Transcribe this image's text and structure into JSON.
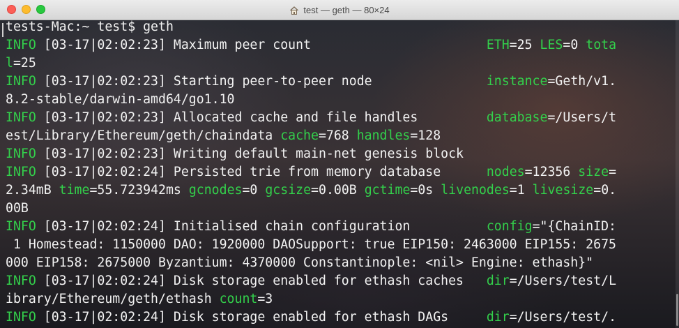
{
  "window": {
    "title": "test — geth — 80×24"
  },
  "terminal": {
    "prompt": "tests-Mac:~ test$ geth",
    "lines": [
      [
        {
          "t": "INFO",
          "c": "lvl"
        },
        {
          "t": " [03-17|02:02:23] Maximum peer count                       "
        },
        {
          "t": "ETH",
          "c": "key"
        },
        {
          "t": "=25 "
        },
        {
          "t": "LES",
          "c": "key"
        },
        {
          "t": "=0 "
        },
        {
          "t": "tota",
          "c": "key"
        }
      ],
      [
        {
          "t": "l",
          "c": "key"
        },
        {
          "t": "=25"
        }
      ],
      [
        {
          "t": "INFO",
          "c": "lvl"
        },
        {
          "t": " [03-17|02:02:23] Starting peer-to-peer node               "
        },
        {
          "t": "instance",
          "c": "key"
        },
        {
          "t": "=Geth/v1."
        }
      ],
      [
        {
          "t": "8.2-stable/darwin-amd64/go1.10"
        }
      ],
      [
        {
          "t": "INFO",
          "c": "lvl"
        },
        {
          "t": " [03-17|02:02:23] Allocated cache and file handles         "
        },
        {
          "t": "database",
          "c": "key"
        },
        {
          "t": "=/Users/t"
        }
      ],
      [
        {
          "t": "est/Library/Ethereum/geth/chaindata "
        },
        {
          "t": "cache",
          "c": "key"
        },
        {
          "t": "=768 "
        },
        {
          "t": "handles",
          "c": "key"
        },
        {
          "t": "=128"
        }
      ],
      [
        {
          "t": "INFO",
          "c": "lvl"
        },
        {
          "t": " [03-17|02:02:23] Writing default main-net genesis block"
        }
      ],
      [
        {
          "t": "INFO",
          "c": "lvl"
        },
        {
          "t": " [03-17|02:02:24] Persisted trie from memory database      "
        },
        {
          "t": "nodes",
          "c": "key"
        },
        {
          "t": "=12356 "
        },
        {
          "t": "size",
          "c": "key"
        },
        {
          "t": "="
        }
      ],
      [
        {
          "t": "2.34mB "
        },
        {
          "t": "time",
          "c": "key"
        },
        {
          "t": "=55.723942ms "
        },
        {
          "t": "gcnodes",
          "c": "key"
        },
        {
          "t": "=0 "
        },
        {
          "t": "gcsize",
          "c": "key"
        },
        {
          "t": "=0.00B "
        },
        {
          "t": "gctime",
          "c": "key"
        },
        {
          "t": "=0s "
        },
        {
          "t": "livenodes",
          "c": "key"
        },
        {
          "t": "=1 "
        },
        {
          "t": "livesize",
          "c": "key"
        },
        {
          "t": "=0."
        }
      ],
      [
        {
          "t": "00B"
        }
      ],
      [
        {
          "t": "INFO",
          "c": "lvl"
        },
        {
          "t": " [03-17|02:02:24] Initialised chain configuration          "
        },
        {
          "t": "config",
          "c": "key"
        },
        {
          "t": "=\"{ChainID:"
        }
      ],
      [
        {
          "t": " 1 Homestead: 1150000 DAO: 1920000 DAOSupport: true EIP150: 2463000 EIP155: 2675"
        }
      ],
      [
        {
          "t": "000 EIP158: 2675000 Byzantium: 4370000 Constantinople: <nil> Engine: ethash}\""
        }
      ],
      [
        {
          "t": "INFO",
          "c": "lvl"
        },
        {
          "t": " [03-17|02:02:24] Disk storage enabled for ethash caches   "
        },
        {
          "t": "dir",
          "c": "key"
        },
        {
          "t": "=/Users/test/L"
        }
      ],
      [
        {
          "t": "ibrary/Ethereum/geth/ethash "
        },
        {
          "t": "count",
          "c": "key"
        },
        {
          "t": "=3"
        }
      ],
      [
        {
          "t": "INFO",
          "c": "lvl"
        },
        {
          "t": " [03-17|02:02:24] Disk storage enabled for ethash DAGs     "
        },
        {
          "t": "dir",
          "c": "key"
        },
        {
          "t": "=/Users/test/."
        }
      ]
    ]
  }
}
